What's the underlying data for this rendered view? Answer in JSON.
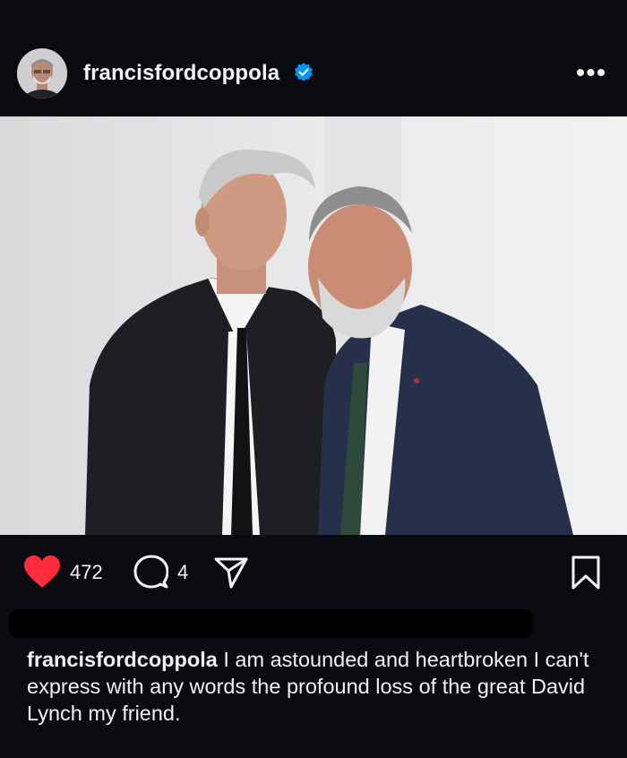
{
  "post": {
    "username": "francisfordcoppola",
    "verified": true,
    "more_label": "•••"
  },
  "actions": {
    "likes": "472",
    "comments": "4",
    "liked": true,
    "like_color": "#ff2b3a"
  },
  "caption": {
    "username": "francisfordcoppola",
    "text": "I am astounded and heartbroken I can't express with any words the profound loss of the great David Lynch my friend."
  },
  "icons": {
    "like": "heart-icon",
    "comment": "comment-bubble-icon",
    "share": "paper-plane-icon",
    "save": "bookmark-icon",
    "verified": "verified-badge-icon",
    "more": "more-options-icon"
  },
  "colors": {
    "background": "#090b10",
    "verified_badge": "#0095f6"
  }
}
